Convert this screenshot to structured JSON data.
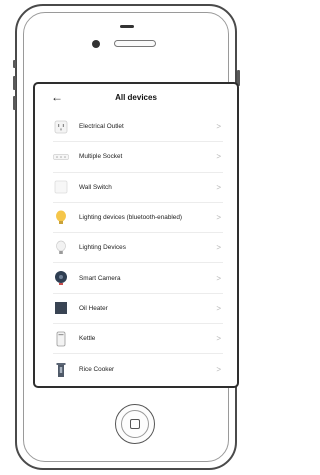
{
  "screen": {
    "title": "All devices",
    "back_icon": "left-arrow-icon"
  },
  "devices": [
    {
      "label": "Electrical Outlet",
      "icon": "outlet-icon",
      "color": "#d9d9d9"
    },
    {
      "label": "Multiple Socket",
      "icon": "power-strip-icon",
      "color": "#dcdcdc"
    },
    {
      "label": "Wall Switch",
      "icon": "wall-switch-icon",
      "color": "#e6e6e6"
    },
    {
      "label": "Lighting devices (bluetooth-enabled)",
      "icon": "yellow-bulb-icon",
      "color": "#f5c64a"
    },
    {
      "label": "Lighting Devices",
      "icon": "white-bulb-icon",
      "color": "#cfcfcf"
    },
    {
      "label": "Smart Camera",
      "icon": "camera-icon",
      "color": "#2f3e52"
    },
    {
      "label": "Oil Heater",
      "icon": "heater-icon",
      "color": "#394453"
    },
    {
      "label": "Kettle",
      "icon": "kettle-icon",
      "color": "#9a9a9a"
    },
    {
      "label": "Rice Cooker",
      "icon": "rice-cooker-icon",
      "color": "#5c6675"
    }
  ],
  "chevron_glyph": ">",
  "back_glyph": "←"
}
